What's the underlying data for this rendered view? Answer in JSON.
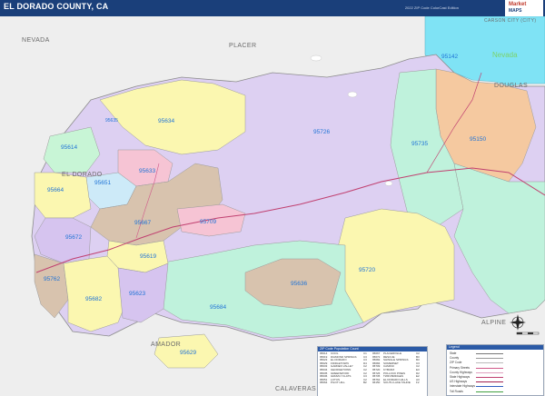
{
  "title": "EL DORADO COUNTY, CA",
  "subtitle": "2022 ZIP Code ColorCast Edition",
  "brand": {
    "line1": "Market",
    "line2": "MAPS"
  },
  "colors": {
    "title_bg": "#1a3f7a",
    "lake_tahoe": "#7fe3f5",
    "outside": "#ededed"
  },
  "region_labels": [
    {
      "id": "nevada",
      "text": "NEVADA"
    },
    {
      "id": "placer",
      "text": "PLACER"
    },
    {
      "id": "douglas",
      "text": "DOUGLAS"
    },
    {
      "id": "carson",
      "text": "CARSON CITY (CITY)"
    },
    {
      "id": "eldorado",
      "text": "EL DORADO"
    },
    {
      "id": "alpine",
      "text": "ALPINE"
    },
    {
      "id": "amador",
      "text": "AMADOR"
    },
    {
      "id": "calaveras",
      "text": "CALAVERAS"
    }
  ],
  "lake_label": "Nevada",
  "zips": [
    {
      "zip": "95142",
      "color": "#7fe3f5"
    },
    {
      "zip": "95634",
      "color": "#fbf7b0"
    },
    {
      "zip": "95614",
      "color": "#c8f5d6"
    },
    {
      "zip": "95633",
      "color": "#f6c4d4"
    },
    {
      "zip": "95635",
      "color": "#d6c4ef"
    },
    {
      "zip": "95651",
      "color": "#cdeaf8"
    },
    {
      "zip": "95664",
      "color": "#fbf7b0"
    },
    {
      "zip": "95667",
      "color": "#d8c3ae"
    },
    {
      "zip": "95709",
      "color": "#f6c4d4"
    },
    {
      "zip": "95726",
      "color": "#ddd0f2"
    },
    {
      "zip": "95735",
      "color": "#bff2dc"
    },
    {
      "zip": "95150",
      "color": "#f5c9a0"
    },
    {
      "zip": "95672",
      "color": "#d6c4ef"
    },
    {
      "zip": "95619",
      "color": "#fbf7b0"
    },
    {
      "zip": "95762",
      "color": "#d8c3ae"
    },
    {
      "zip": "95682",
      "color": "#fbf7b0"
    },
    {
      "zip": "95623",
      "color": "#d6c4ef"
    },
    {
      "zip": "95684",
      "color": "#bff2dc"
    },
    {
      "zip": "95636",
      "color": "#d8c3ae"
    },
    {
      "zip": "95720",
      "color": "#fbf7b0"
    },
    {
      "zip": "95629",
      "color": "#fbf7b0"
    }
  ],
  "zip_table": {
    "header": "ZIP Code  Population  Count",
    "left": [
      {
        "code": "95614",
        "name": "COOL",
        "cnt": "C1"
      },
      {
        "code": "95619",
        "name": "DIAMOND SPRINGS",
        "cnt": "C3"
      },
      {
        "code": "95623",
        "name": "EL DORADO",
        "cnt": "C3"
      },
      {
        "code": "95629",
        "name": "FIDDLETOWN",
        "cnt": "D4"
      },
      {
        "code": "95633",
        "name": "GARDEN VALLEY",
        "cnt": "C2"
      },
      {
        "code": "95634",
        "name": "GEORGETOWN",
        "cnt": "C2"
      },
      {
        "code": "95635",
        "name": "GREENWOOD",
        "cnt": "C2"
      },
      {
        "code": "95636",
        "name": "GRIZZLY FLATS",
        "cnt": "C3"
      },
      {
        "code": "95651",
        "name": "LOTUS",
        "cnt": "C2"
      },
      {
        "code": "95664",
        "name": "PILOT HILL",
        "cnt": "B2"
      }
    ],
    "right": [
      {
        "code": "95667",
        "name": "PLACERVILLE",
        "cnt": "C2"
      },
      {
        "code": "95672",
        "name": "RESCUE",
        "cnt": "B3"
      },
      {
        "code": "95682",
        "name": "SHINGLE SPRINGS",
        "cnt": "B3"
      },
      {
        "code": "95684",
        "name": "SOMERSET",
        "cnt": "C3"
      },
      {
        "code": "95709",
        "name": "CAMINO",
        "cnt": "C2"
      },
      {
        "code": "95720",
        "name": "KYBURZ",
        "cnt": "E3"
      },
      {
        "code": "95726",
        "name": "POLLOCK PINES",
        "cnt": "D2"
      },
      {
        "code": "95735",
        "name": "TWIN BRIDGES",
        "cnt": "E2"
      },
      {
        "code": "95762",
        "name": "EL DORADO HILLS",
        "cnt": "A3"
      },
      {
        "code": "96150",
        "name": "SOUTH LAKE TAHOE",
        "cnt": "F2"
      }
    ]
  },
  "legend": {
    "header": "Legend",
    "rows": [
      {
        "label": "State",
        "color": "#777777"
      },
      {
        "label": "County",
        "color": "#999999"
      },
      {
        "label": "ZIP Code",
        "color": "#bbbbbb"
      },
      {
        "label": "Primary Streets",
        "color": "#d05a8a"
      },
      {
        "label": "County Highways",
        "color": "#e0a0c0"
      },
      {
        "label": "State Highways",
        "color": "#c04070"
      },
      {
        "label": "US Highways",
        "color": "#a02050"
      },
      {
        "label": "Interstate Highways",
        "color": "#3060c0"
      },
      {
        "label": "Toll Roads",
        "color": "#40a040"
      }
    ]
  }
}
